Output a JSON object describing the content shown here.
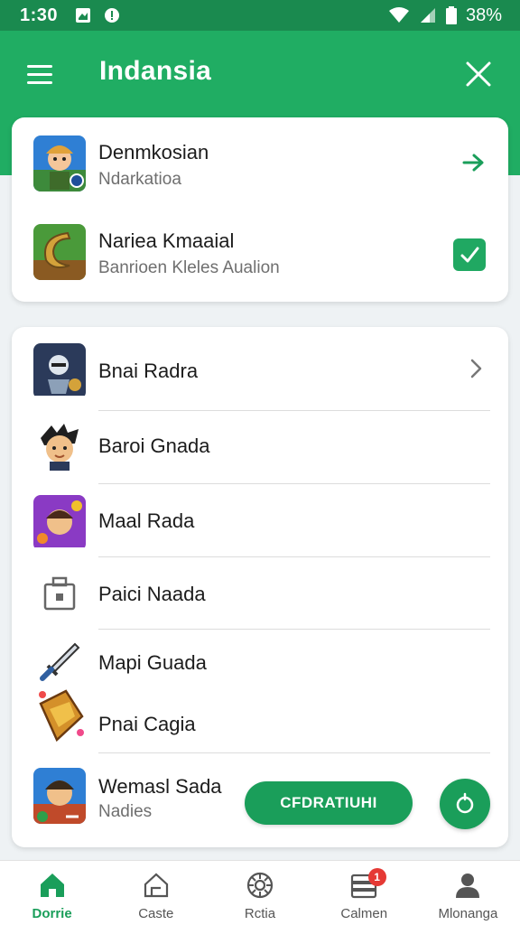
{
  "status_bar": {
    "time": "1:30",
    "battery": "38%"
  },
  "app_bar": {
    "title": "Indansia"
  },
  "card1": {
    "items": [
      {
        "title": "Denmkosian",
        "subtitle": "Ndarkatioa"
      },
      {
        "title": "Nariea Kmaaial",
        "subtitle": "Banrioen Kleles Aualion"
      }
    ]
  },
  "card2": {
    "items": [
      {
        "title": "Bnai Radra"
      },
      {
        "title": "Baroi Gnada"
      },
      {
        "title": "Maal Rada"
      },
      {
        "title": "Paici Naada"
      },
      {
        "title": "Mapi Guada"
      },
      {
        "title": "Pnai Cagia"
      },
      {
        "title": "Wemasl Sada",
        "subtitle": "Nadies"
      }
    ],
    "action_button": "CFDRATIUHI"
  },
  "bottom_nav": {
    "items": [
      {
        "label": "Dorrie",
        "icon": "home-icon"
      },
      {
        "label": "Caste",
        "icon": "house-outline-icon"
      },
      {
        "label": "Rctia",
        "icon": "gear-circle-icon"
      },
      {
        "label": "Calmen",
        "icon": "inbox-icon",
        "badge": "1"
      },
      {
        "label": "Mlonanga",
        "icon": "person-icon"
      }
    ]
  },
  "colors": {
    "primary": "#20ad63",
    "primary_dark": "#1a8a4f",
    "accent": "#1a9e5a",
    "badge": "#e53935"
  }
}
